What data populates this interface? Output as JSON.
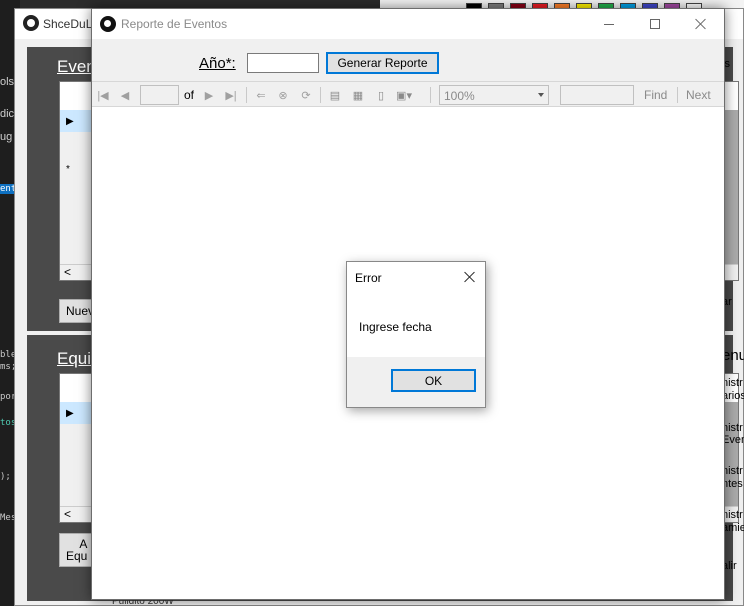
{
  "background": {
    "app_title": "ShceDuL",
    "left_edge_texts": [
      "dic",
      "ug",
      "ols"
    ],
    "editor_lines": [
      "ble",
      "ms;",
      "por",
      "tos",
      ");",
      "Mes"
    ],
    "selected_editor_label": "ento",
    "panel1_heading": "Even",
    "panel2_heading": "Equi",
    "grid_row_marker": "*",
    "grid_scroll_arrow": "<",
    "btn_new": "Nuev",
    "btn_equip_line1": "A",
    "btn_equip_line2": "Equ",
    "right_items": [
      "ls",
      "ar",
      "enu",
      "nistr",
      "arios",
      "nistr",
      "Even",
      "nistr",
      "ntes",
      "nistr",
      "amie",
      "alir"
    ],
    "bottom_text": "Pulidito 200W"
  },
  "window": {
    "title": "Reporte de Eventos",
    "minimize_label": "Minimize",
    "maximize_label": "Maximize",
    "close_label": "Close"
  },
  "form": {
    "year_label": "Año*:",
    "year_value": "",
    "generate_button": "Generar Reporte"
  },
  "report_toolbar": {
    "page_value": "",
    "of_label": "of",
    "zoom_value": "100%",
    "find_value": "",
    "find_label": "Find",
    "next_label": "Next",
    "icons": [
      "first-page-icon",
      "previous-page-icon",
      "next-page-icon",
      "last-page-icon",
      "back-icon",
      "stop-icon",
      "refresh-icon",
      "print-icon",
      "print-layout-icon",
      "page-setup-icon",
      "export-icon"
    ]
  },
  "dialog": {
    "title": "Error",
    "message": "Ingrese fecha",
    "ok_button": "OK"
  }
}
